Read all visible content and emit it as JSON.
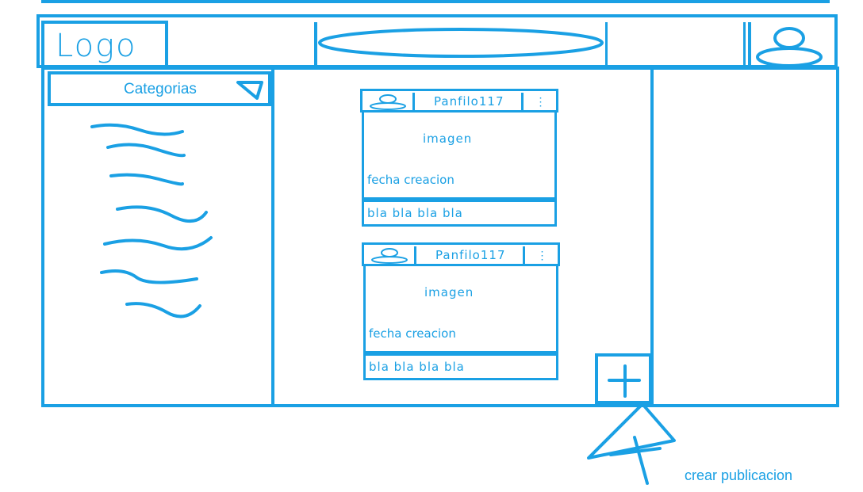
{
  "header": {
    "logo_text": "Logo",
    "search_icon": "search-bar-ellipse",
    "profile_icon": "user-icon"
  },
  "sidebar": {
    "title": "Categorias",
    "dropdown_icon": "triangle-dropdown-icon",
    "items_placeholder_count": 7
  },
  "posts": [
    {
      "username": "Panfilo117",
      "menu": "⋮",
      "image_label": "imagen",
      "date_label": "fecha creacion",
      "text": "bla bla bla bla"
    },
    {
      "username": "Panfilo117",
      "menu": "⋮",
      "image_label": "imagen",
      "date_label": "fecha creacion",
      "text": "bla bla bla bla"
    }
  ],
  "actions": {
    "add_icon": "plus-icon"
  },
  "annotation": {
    "label": "crear publicacion"
  },
  "colors": {
    "stroke": "#1aa0e4",
    "background": "#ffffff"
  }
}
